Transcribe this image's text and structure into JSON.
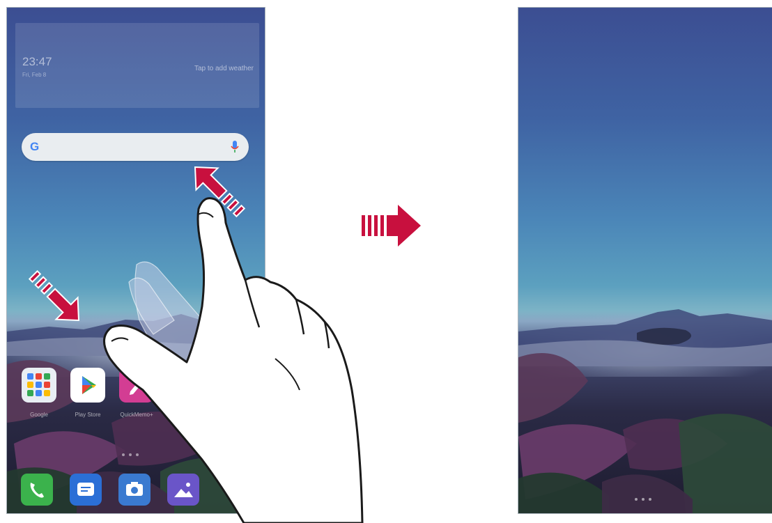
{
  "left_screen": {
    "widget": {
      "time": "23:47",
      "date": "Fri, Feb 8",
      "weather": "Tap to add weather"
    },
    "search": {
      "logo": "G"
    },
    "apps": [
      {
        "label": "Google",
        "icon": "google-folder-icon",
        "color": "#e9eef3"
      },
      {
        "label": "Play Store",
        "icon": "play-store-icon",
        "color": "#ffffff"
      },
      {
        "label": "QuickMemo+",
        "icon": "quickmemo-icon",
        "color": "#d33d93"
      }
    ],
    "dock": [
      {
        "icon": "phone-icon",
        "color": "#3bb24c"
      },
      {
        "icon": "messages-icon",
        "color": "#2b6fd6"
      },
      {
        "icon": "camera-icon",
        "color": "#3a7ad0"
      },
      {
        "icon": "gallery-icon",
        "color": "#6a55c8"
      }
    ]
  },
  "colors": {
    "arrow": "#c8103e",
    "outline": "#1a1a1a"
  }
}
